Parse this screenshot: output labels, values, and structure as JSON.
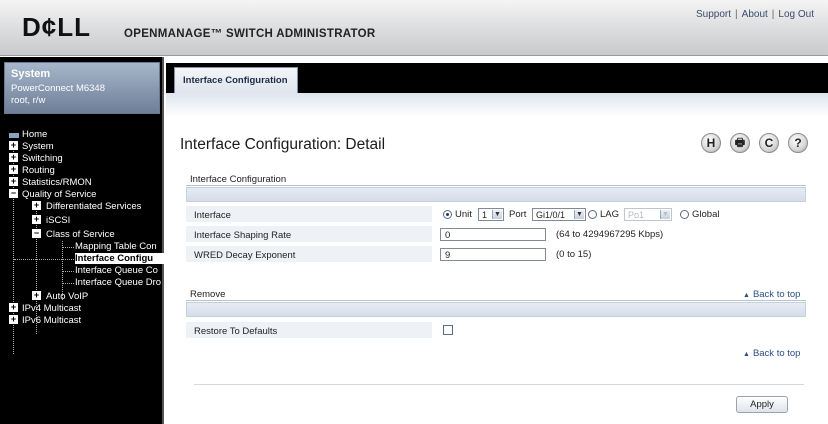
{
  "header": {
    "logo": "D¢LL",
    "app_title": "OPENMANAGE™ SWITCH ADMINISTRATOR",
    "links": {
      "support": "Support",
      "about": "About",
      "logout": "Log Out",
      "sep": "|"
    }
  },
  "system": {
    "title": "System",
    "model": "PowerConnect M6348",
    "user": "root, r/w"
  },
  "nav": {
    "home": "Home",
    "system": "System",
    "switching": "Switching",
    "routing": "Routing",
    "stats": "Statistics/RMON",
    "qos": "Quality of Service",
    "diffserv": "Differentiated Services",
    "iscsi": "iSCSI",
    "cos": "Class of Service",
    "mapping": "Mapping Table Con",
    "iface_config": "Interface Configu",
    "iface_queue_config": "Interface Queue Co",
    "iface_queue_drop": "Interface Queue Dro",
    "autovoip": "Auto VoIP",
    "ipv4mc": "IPv4 Multicast",
    "ipv6mc": "IPv6 Multicast"
  },
  "tab": {
    "label": "Interface Configuration"
  },
  "page": {
    "title": "Interface Configuration: Detail"
  },
  "tools": {
    "help": "H",
    "print": "🖶",
    "refresh": "C",
    "question": "?"
  },
  "section1": {
    "header": "Interface Configuration",
    "interface_label": "Interface",
    "unit_label": "Unit",
    "unit_value": "1",
    "port_label": "Port",
    "port_value": "Gi1/0/1",
    "lag_label": "LAG",
    "lag_value": "Po1",
    "global_label": "Global",
    "shaping_label": "Interface Shaping Rate",
    "shaping_value": "0",
    "shaping_hint": "(64 to 4294967295 Kbps)",
    "wred_label": "WRED Decay Exponent",
    "wred_value": "9",
    "wred_hint": "(0 to 15)"
  },
  "section2": {
    "header": "Remove",
    "restore_label": "Restore To Defaults",
    "back_to_top": "Back to top"
  },
  "apply_label": "Apply",
  "chevron": "▼",
  "triangle": "▲"
}
